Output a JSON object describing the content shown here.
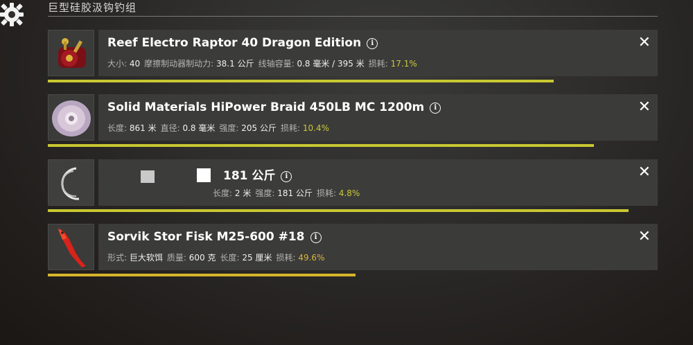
{
  "header": {
    "title": "巨型硅胶汲钩钓组"
  },
  "items": [
    {
      "name": "Reef Electro Raptor 40 Dragon Edition",
      "icon": "reel-icon",
      "stats": [
        {
          "label": "大小:",
          "value": "40"
        },
        {
          "label": "摩擦制动器制动力:",
          "value": "38.1 公斤"
        },
        {
          "label": "线轴容量:",
          "value": "0.8 毫米 / 395 米"
        }
      ],
      "wear_label": "损耗:",
      "wear": "17.1%",
      "durability": 0.829
    },
    {
      "name": "Solid Materials HiPower Braid 450LB MC 1200m",
      "icon": "line-spool-icon",
      "stats": [
        {
          "label": "长度:",
          "value": "861 米"
        },
        {
          "label": "直径:",
          "value": "0.8 毫米"
        },
        {
          "label": "强度:",
          "value": "205 公斤"
        }
      ],
      "wear_label": "损耗:",
      "wear": "10.4%",
      "durability": 0.896
    },
    {
      "name": "181 公斤",
      "icon": "leader-icon",
      "stats": [
        {
          "label": "长度:",
          "value": "2 米"
        },
        {
          "label": "强度:",
          "value": "181 公斤"
        }
      ],
      "wear_label": "损耗:",
      "wear": "4.8%",
      "durability": 0.952
    },
    {
      "name": "Sorvik Stor Fisk M25-600 #18",
      "icon": "soft-lure-icon",
      "stats": [
        {
          "label": "形式:",
          "value": "巨大软饵"
        },
        {
          "label": "质量:",
          "value": "600 克"
        },
        {
          "label": "长度:",
          "value": "25 厘米"
        }
      ],
      "wear_label": "损耗:",
      "wear": "49.6%",
      "durability": 0.504
    }
  ],
  "colors": {
    "wear_low": "#c9c93a",
    "wear_high": "#d9b63a",
    "bar": "#c8c832"
  },
  "close_glyph": "✕",
  "info_glyph": "i"
}
